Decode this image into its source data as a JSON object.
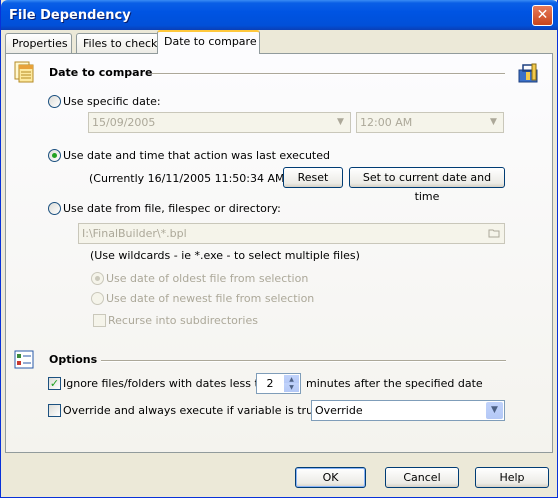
{
  "window": {
    "title": "File Dependency",
    "close_glyph": "✕"
  },
  "tabs": [
    {
      "label": "Properties"
    },
    {
      "label": "Files to check"
    },
    {
      "label": "Date to compare"
    }
  ],
  "date_section": {
    "title": "Date to compare",
    "specific_date": {
      "label": "Use specific date:",
      "date_value": "15/09/2005",
      "time_value": "12:00 AM"
    },
    "last_executed": {
      "label": "Use date and time that action was last executed",
      "currently": "(Currently 16/11/2005 11:50:34 AM)",
      "reset_label": "Reset",
      "set_current_label": "Set to current date and time"
    },
    "from_file": {
      "label": "Use date from file, filespec or directory:",
      "path_value": "I:\\FinalBuilder\\*.bpl",
      "wildcard_hint": "(Use wildcards - ie *.exe - to select multiple files)",
      "oldest_label": "Use date of oldest file from selection",
      "newest_label": "Use date of newest file from selection",
      "recurse_label": "Recurse into subdirectories"
    }
  },
  "options_section": {
    "title": "Options",
    "ignore_label": "Ignore files/folders with dates less than",
    "ignore_minutes": "2",
    "minutes_suffix": "minutes after the specified date",
    "override_label": "Override and always execute if variable is true:",
    "override_value": "Override"
  },
  "footer": {
    "ok_label": "OK",
    "cancel_label": "Cancel",
    "help_label": "Help"
  },
  "icons": {
    "calendar": "calendar-files-icon",
    "toolbox": "toolbox-icon",
    "options": "options-list-icon",
    "dropdown": "▼",
    "spin_up": "▲",
    "spin_down": "▼",
    "checkmark": "✓"
  }
}
